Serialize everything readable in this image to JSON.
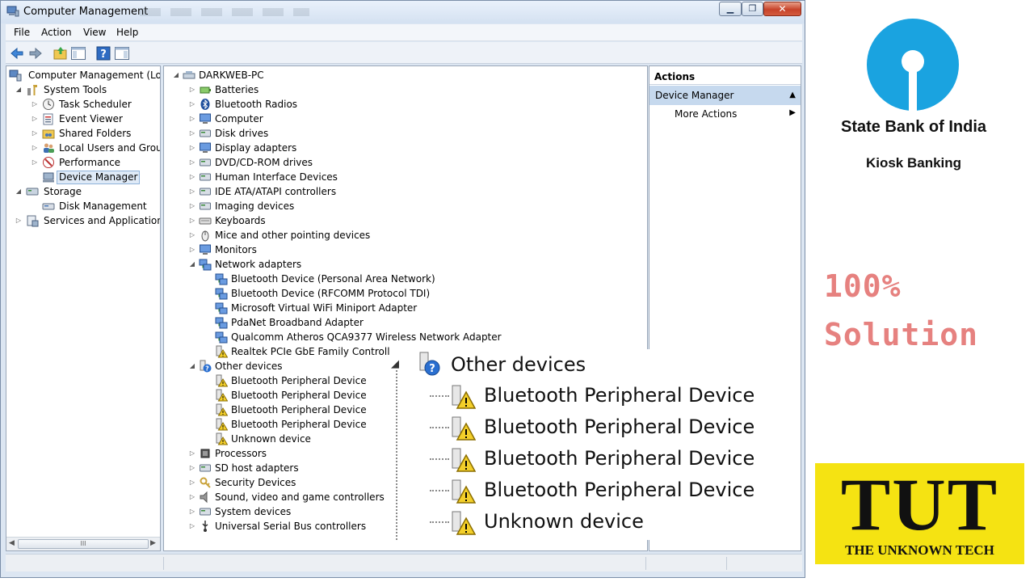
{
  "window": {
    "title": "Computer Management",
    "min_glyph": "▁",
    "max_glyph": "❐",
    "close_glyph": "✕"
  },
  "menu": [
    "File",
    "Action",
    "View",
    "Help"
  ],
  "left_tree": {
    "root": "Computer Management (Local",
    "items": [
      {
        "label": "System Tools"
      },
      {
        "label": "Task Scheduler"
      },
      {
        "label": "Event Viewer"
      },
      {
        "label": "Shared Folders"
      },
      {
        "label": "Local Users and Groups"
      },
      {
        "label": "Performance"
      },
      {
        "label": "Device Manager"
      },
      {
        "label": "Storage"
      },
      {
        "label": "Disk Management"
      },
      {
        "label": "Services and Applications"
      }
    ]
  },
  "device_tree": {
    "root": "DARKWEB-PC",
    "items": [
      "Batteries",
      "Bluetooth Radios",
      "Computer",
      "Disk drives",
      "Display adapters",
      "DVD/CD-ROM drives",
      "Human Interface Devices",
      "IDE ATA/ATAPI controllers",
      "Imaging devices",
      "Keyboards",
      "Mice and other pointing devices",
      "Monitors",
      "Network adapters",
      "Bluetooth Device (Personal Area Network)",
      "Bluetooth Device (RFCOMM Protocol TDI)",
      "Microsoft Virtual WiFi Miniport Adapter",
      "PdaNet Broadband Adapter",
      "Qualcomm Atheros QCA9377 Wireless Network Adapter",
      "Realtek PCIe GbE Family Controller",
      "Other devices",
      "Bluetooth Peripheral Device",
      "Bluetooth Peripheral Device",
      "Bluetooth Peripheral Device",
      "Bluetooth Peripheral Device",
      "Unknown device",
      "Processors",
      "SD host adapters",
      "Security Devices",
      "Sound, video and game controllers",
      "System devices",
      "Universal Serial Bus controllers"
    ]
  },
  "actions": {
    "header": "Actions",
    "section": "Device Manager",
    "more": "More Actions"
  },
  "zoom": {
    "group": "Other devices",
    "items": [
      "Bluetooth Peripheral Device",
      "Bluetooth Peripheral Device",
      "Bluetooth Peripheral Device",
      "Bluetooth Peripheral Device",
      "Unknown device"
    ]
  },
  "brand": {
    "name": "State Bank of India",
    "subtitle": "Kiosk Banking",
    "promo_line1": "100%",
    "promo_line2": "Solution",
    "tut_big": "TUT",
    "tut_small": "THE UNKNOWN TECH",
    "sbi_color": "#1aa3e0",
    "tut_color": "#f5e312",
    "promo_color": "#e6817f"
  },
  "scroll": {
    "thumb_glyph": "III"
  }
}
